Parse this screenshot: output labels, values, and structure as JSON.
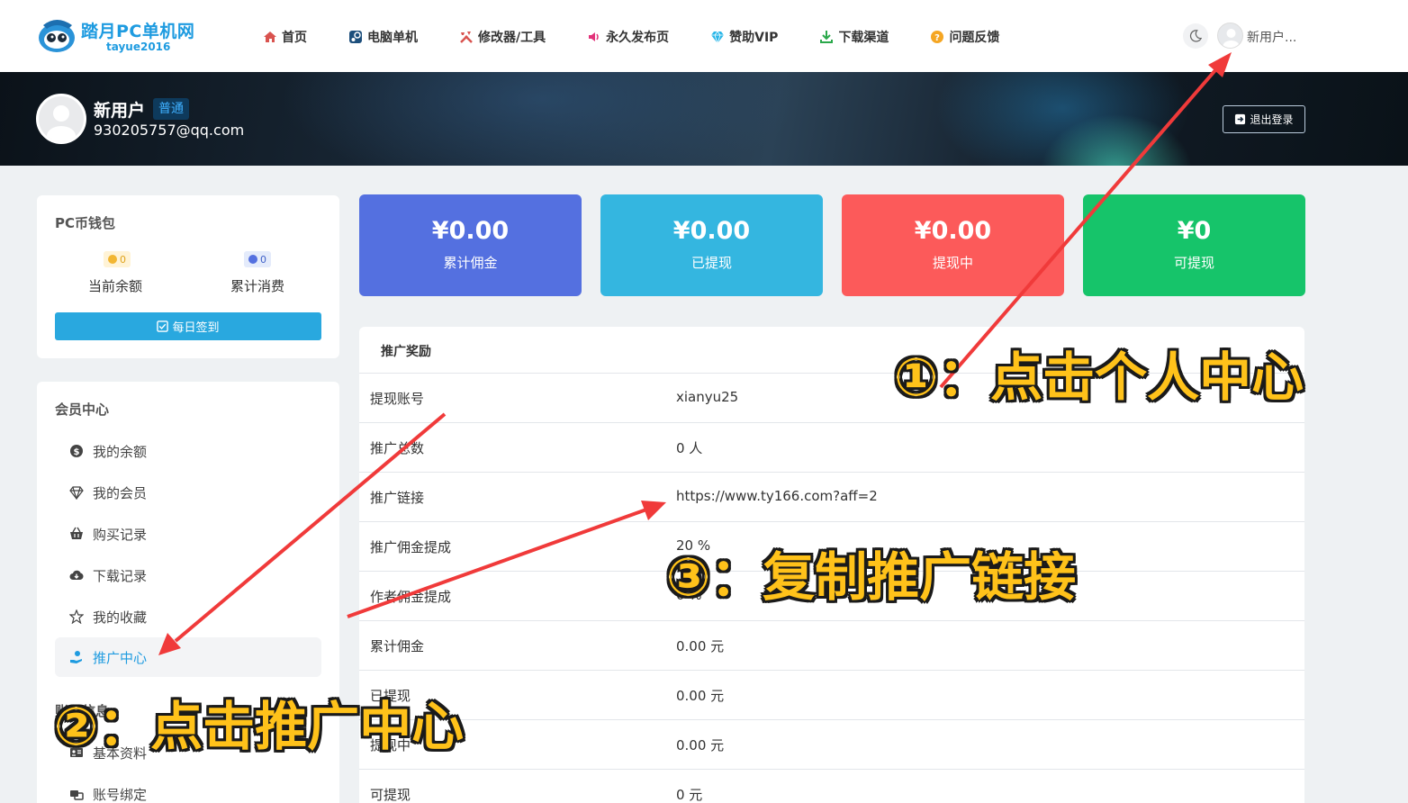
{
  "site": {
    "title": "踏月PC单机网",
    "subtitle": "tayue2016"
  },
  "nav": [
    {
      "label": "首页",
      "icon": "home-icon"
    },
    {
      "label": "电脑单机",
      "icon": "steam-icon"
    },
    {
      "label": "修改器/工具",
      "icon": "tools-icon"
    },
    {
      "label": "永久发布页",
      "icon": "speaker-icon"
    },
    {
      "label": "赞助VIP",
      "icon": "diamond-icon"
    },
    {
      "label": "下载渠道",
      "icon": "download-icon"
    },
    {
      "label": "问题反馈",
      "icon": "question-icon"
    }
  ],
  "header": {
    "user_short": "新用户..."
  },
  "profile": {
    "name": "新用户",
    "badge": "普通",
    "email": "930205757@qq.com",
    "logout": "退出登录"
  },
  "wallet": {
    "title": "PC币钱包",
    "balance": {
      "value": "0",
      "label": "当前余额"
    },
    "spent": {
      "value": "0",
      "label": "累计消费"
    },
    "checkin": "每日签到"
  },
  "member": {
    "title": "会员中心",
    "items": [
      {
        "label": "我的余额",
        "icon": "dollar-icon"
      },
      {
        "label": "我的会员",
        "icon": "diamond-icon"
      },
      {
        "label": "购买记录",
        "icon": "basket-icon"
      },
      {
        "label": "下载记录",
        "icon": "cloud-download-icon"
      },
      {
        "label": "我的收藏",
        "icon": "star-icon"
      },
      {
        "label": "推广中心",
        "icon": "hand-coin-icon"
      }
    ],
    "section2_title": "账号信息",
    "items2": [
      {
        "label": "基本资料",
        "icon": "id-card-icon"
      },
      {
        "label": "账号绑定",
        "icon": "link-icon"
      }
    ]
  },
  "stats": [
    {
      "value": "¥0.00",
      "label": "累计佣金",
      "color": "#5470e0"
    },
    {
      "value": "¥0.00",
      "label": "已提现",
      "color": "#34b6e0"
    },
    {
      "value": "¥0.00",
      "label": "提现中",
      "color": "#fc5a5a"
    },
    {
      "value": "¥0",
      "label": "可提现",
      "color": "#16c46a"
    }
  ],
  "rewards": {
    "title": "推广奖励",
    "rows": [
      {
        "key": "提现账号",
        "value": "xianyu25"
      },
      {
        "key": "推广总数",
        "value": "0 人"
      },
      {
        "key": "推广链接",
        "value": "https://www.ty166.com?aff=2"
      },
      {
        "key": "推广佣金提成",
        "value": "20 %"
      },
      {
        "key": "作者佣金提成",
        "value": "0 %"
      },
      {
        "key": "累计佣金",
        "value": "0.00 元"
      },
      {
        "key": "已提现",
        "value": "0.00 元"
      },
      {
        "key": "提现中",
        "value": "0.00 元"
      },
      {
        "key": "可提现",
        "value": "0 元"
      }
    ]
  },
  "annotations": {
    "step1": "①：点击个人中心",
    "step2": "②：点击推广中心",
    "step3": "③：复制推广链接",
    "color": "#ffc21a",
    "arrow_color": "#f03a3a"
  }
}
